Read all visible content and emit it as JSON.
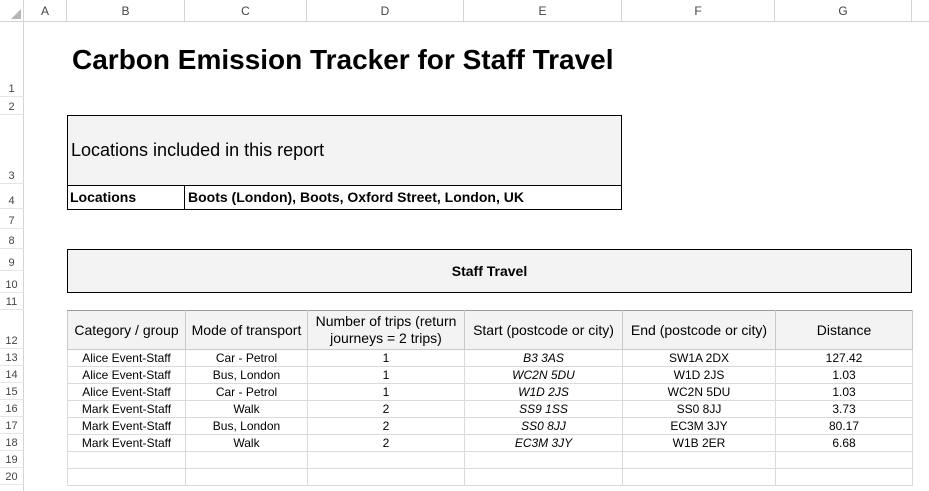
{
  "sheet": {
    "columns": [
      "A",
      "B",
      "C",
      "D",
      "E",
      "F",
      "G"
    ],
    "rows": [
      "1",
      "2",
      "3",
      "4",
      "7",
      "8",
      "9",
      "10",
      "11",
      "12",
      "13",
      "14",
      "15",
      "16",
      "17",
      "18",
      "19",
      "20"
    ]
  },
  "title": "Carbon Emission Tracker for Staff Travel",
  "locations": {
    "heading": "Locations included in this report",
    "label": "Locations",
    "value": "Boots (London), Boots, Oxford Street, London, UK"
  },
  "travel": {
    "banner": "Staff Travel",
    "headers": [
      "Category / group",
      "Mode of transport",
      "Number of trips (return journeys = 2 trips)",
      "Start (postcode or city)",
      "End (postcode or city)",
      "Distance"
    ],
    "rows": [
      [
        "Alice Event-Staff",
        "Car - Petrol",
        "1",
        "B3 3AS",
        "SW1A 2DX",
        "127.42"
      ],
      [
        "Alice Event-Staff",
        "Bus, London",
        "1",
        "WC2N 5DU",
        "W1D 2JS",
        "1.03"
      ],
      [
        "Alice Event-Staff",
        "Car - Petrol",
        "1",
        "W1D 2JS",
        "WC2N 5DU",
        "1.03"
      ],
      [
        "Mark Event-Staff",
        "Walk",
        "2",
        "SS9 1SS",
        "SS0 8JJ",
        "3.73"
      ],
      [
        "Mark Event-Staff",
        "Bus, London",
        "2",
        "SS0 8JJ",
        "EC3M 3JY",
        "80.17"
      ],
      [
        "Mark Event-Staff",
        "Walk",
        "2",
        "EC3M 3JY",
        "W1B 2ER",
        "6.68"
      ]
    ]
  }
}
